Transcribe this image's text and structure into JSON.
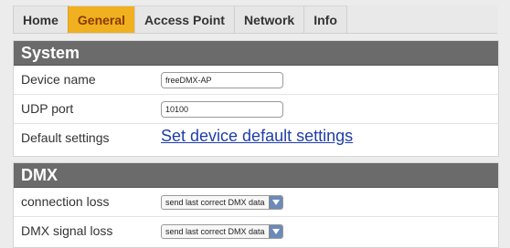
{
  "tabs": [
    {
      "label": "Home",
      "active": false
    },
    {
      "label": "General",
      "active": true
    },
    {
      "label": "Access Point",
      "active": false
    },
    {
      "label": "Network",
      "active": false
    },
    {
      "label": "Info",
      "active": false
    }
  ],
  "colors": {
    "active_tab": "#f0b020",
    "section_header": "#6b6b6b",
    "link": "#1f3ea8"
  },
  "system": {
    "title": "System",
    "device_name": {
      "label": "Device name",
      "value": "freeDMX-AP"
    },
    "udp_port": {
      "label": "UDP port",
      "value": "10100"
    },
    "default_settings": {
      "label": "Default settings",
      "link": "Set device default settings"
    }
  },
  "dmx": {
    "title": "DMX",
    "connection_loss": {
      "label": "connection loss",
      "value": "send last correct DMX data"
    },
    "signal_loss": {
      "label": "DMX signal loss",
      "value": "send last correct DMX data"
    }
  }
}
